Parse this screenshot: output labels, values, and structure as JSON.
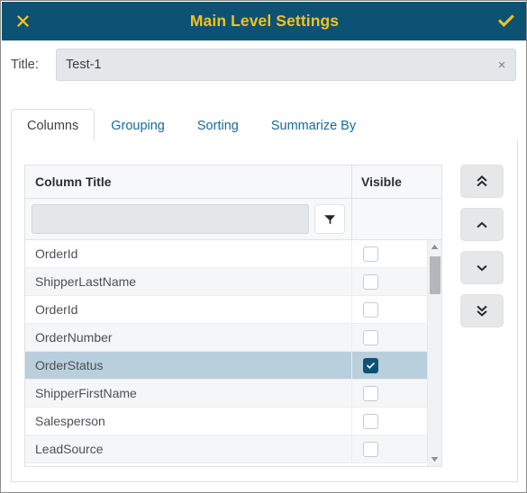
{
  "window": {
    "title": "Main Level Settings",
    "close_icon": "close-x-icon",
    "confirm_icon": "check-icon",
    "header_bg": "#0b5273",
    "header_fg": "#f5c11e"
  },
  "title_field": {
    "label": "Title:",
    "value": "Test-1",
    "placeholder": "",
    "clear_icon": "clear-x-icon",
    "clear_glyph": "×"
  },
  "tabs": [
    {
      "label": "Columns",
      "active": true
    },
    {
      "label": "Grouping",
      "active": false
    },
    {
      "label": "Sorting",
      "active": false
    },
    {
      "label": "Summarize By",
      "active": false
    }
  ],
  "grid": {
    "columns": [
      {
        "header": "Column Title",
        "key": "title"
      },
      {
        "header": "Visible",
        "key": "visible"
      }
    ],
    "filter_row": {
      "input_value": "",
      "input_placeholder": "",
      "filter_icon": "funnel-filter-icon"
    },
    "rows": [
      {
        "title": "OrderId",
        "visible": false,
        "selected": false
      },
      {
        "title": "ShipperLastName",
        "visible": false,
        "selected": false
      },
      {
        "title": "OrderId",
        "visible": false,
        "selected": false
      },
      {
        "title": "OrderNumber",
        "visible": false,
        "selected": false
      },
      {
        "title": "OrderStatus",
        "visible": true,
        "selected": true
      },
      {
        "title": "ShipperFirstName",
        "visible": false,
        "selected": false
      },
      {
        "title": "Salesperson",
        "visible": false,
        "selected": false
      },
      {
        "title": "LeadSource",
        "visible": false,
        "selected": false
      }
    ],
    "scrollbar": {
      "up_arrow_icon": "scroll-up-arrow-icon",
      "down_arrow_icon": "scroll-down-arrow-icon",
      "thumb_icon": "scrollbar-thumb"
    },
    "selected_row_bg": "#b9cfdc",
    "checked_checkbox_color": "#0b5273"
  },
  "reorder_buttons": [
    {
      "name": "move-to-top-button",
      "icon": "double-chevron-up-icon"
    },
    {
      "name": "move-up-button",
      "icon": "chevron-up-icon"
    },
    {
      "name": "move-down-button",
      "icon": "chevron-down-icon"
    },
    {
      "name": "move-to-bottom-button",
      "icon": "double-chevron-down-icon"
    }
  ]
}
